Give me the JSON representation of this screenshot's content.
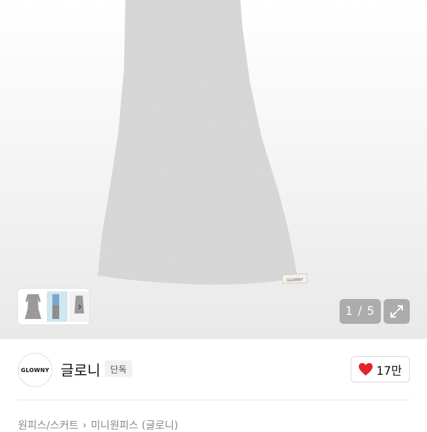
{
  "gallery": {
    "counter_text": "1 / 5",
    "chevron": "›",
    "dress_label": "GLOWNY"
  },
  "brand": {
    "logo_text": "GLOWNY",
    "name": "글로니",
    "badge": "단독"
  },
  "like": {
    "count": "17만",
    "icon_color": "#e0242e"
  },
  "breadcrumb": {
    "items": [
      "원피스/스커트",
      "미니원피스 (글로니)"
    ],
    "separator": "›"
  }
}
